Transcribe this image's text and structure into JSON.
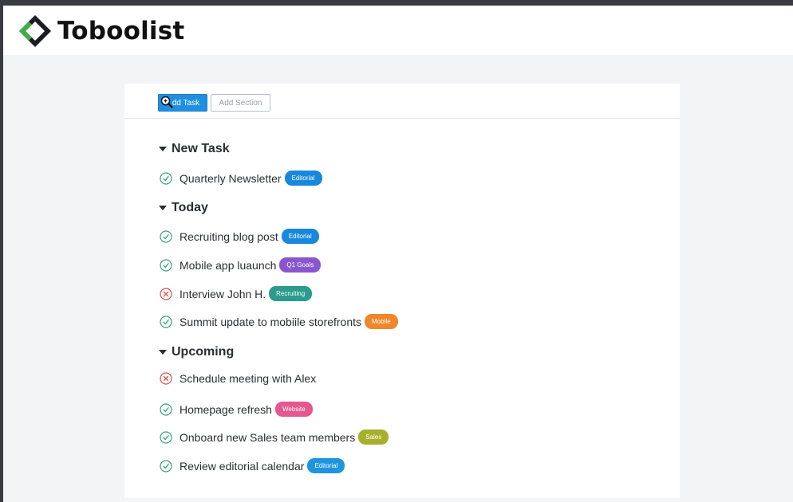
{
  "app": {
    "name": "Toboolist"
  },
  "toolbar": {
    "add_task_label": "dd Task",
    "add_section_label": "Add Section"
  },
  "colors": {
    "primary": "#1f8fe0",
    "done": "#3aa17e",
    "cancelled": "#d9534f",
    "logo_green": "#3fae49",
    "logo_dark": "#1c1d21"
  },
  "sections": [
    {
      "title": "New Task",
      "tasks": [
        {
          "label": "Quarterly Newsletter",
          "status": "done",
          "tag": {
            "label": "Editorial",
            "color": "#1788db"
          }
        }
      ]
    },
    {
      "title": "Today",
      "tasks": [
        {
          "label": "Recruiting blog post",
          "status": "done",
          "tag": {
            "label": "Editorial",
            "color": "#1788db"
          }
        },
        {
          "label": "Mobile app luaunch",
          "status": "done",
          "tag": {
            "label": "Q1 Goals",
            "color": "#8a56cf"
          }
        },
        {
          "label": "Interview John H.",
          "status": "cancelled",
          "tag": {
            "label": "Recruiting",
            "color": "#2a9b8c"
          }
        },
        {
          "label": "Summit update to mobiile storefronts",
          "status": "done",
          "tag": {
            "label": "Mobile",
            "color": "#f0862a"
          }
        }
      ]
    },
    {
      "title": "Upcoming",
      "tasks": [
        {
          "label": "Schedule meeting with Alex",
          "status": "cancelled",
          "tag": null
        },
        {
          "label": "Homepage refresh",
          "status": "done",
          "tag": {
            "label": "Website",
            "color": "#e4578f"
          }
        },
        {
          "label": "Onboard new Sales team members",
          "status": "done",
          "tag": {
            "label": "Sales",
            "color": "#a7b02c"
          }
        },
        {
          "label": "Review editorial calendar",
          "status": "done",
          "tag": {
            "label": "Editorial",
            "color": "#1f95e0"
          }
        }
      ]
    }
  ]
}
